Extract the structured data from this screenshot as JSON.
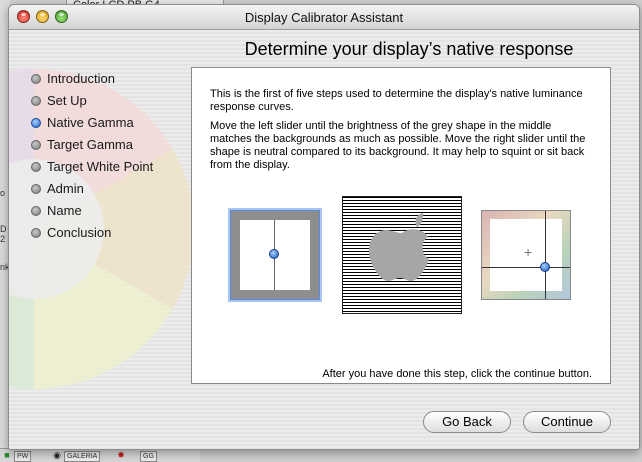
{
  "background": {
    "window_tab_title": "Color LCD PB G4",
    "left_fragments": [
      "o",
      "D 2",
      "nki"
    ],
    "taskbar": [
      "PW",
      "GALERIA",
      "GG"
    ]
  },
  "window": {
    "title": "Display Calibrator Assistant"
  },
  "page": {
    "heading": "Determine your display’s native response"
  },
  "steps": [
    {
      "label": "Introduction",
      "state": "done"
    },
    {
      "label": "Set Up",
      "state": "done"
    },
    {
      "label": "Native Gamma",
      "state": "active"
    },
    {
      "label": "Target Gamma",
      "state": "pending"
    },
    {
      "label": "Target White Point",
      "state": "pending"
    },
    {
      "label": "Admin",
      "state": "pending"
    },
    {
      "label": "Name",
      "state": "pending"
    },
    {
      "label": "Conclusion",
      "state": "pending"
    }
  ],
  "content": {
    "paragraph1": "This is the first of five steps used to determine the display's native luminance response curves.",
    "paragraph2": "Move the left slider until the brightness of the grey shape in the middle matches the backgrounds as much as possible.  Move the right slider until the shape is neutral compared to its background.  It may help to squint or sit back from the display.",
    "footer": "After you have done this step, click the continue button."
  },
  "icons": {
    "apple": "apple-logo-icon",
    "crosshair": "plus-icon"
  },
  "colors": {
    "accent": "#1f5fc4",
    "stripe_dark": "#000000",
    "apple_grey": "#a6a6a6"
  },
  "buttons": {
    "back": "Go Back",
    "continue": "Continue"
  }
}
